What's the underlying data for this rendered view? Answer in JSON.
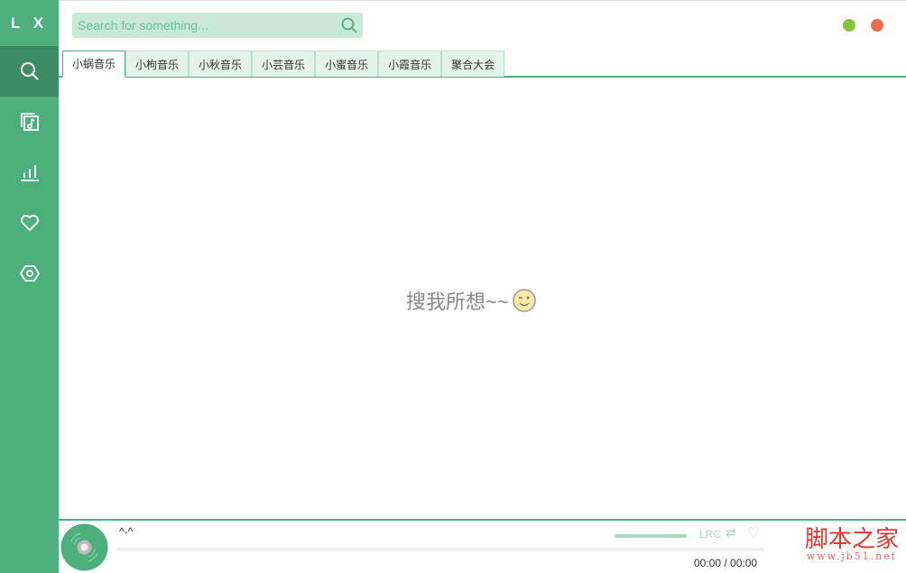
{
  "app": {
    "logo": "L X"
  },
  "sidebar": {
    "items": [
      {
        "name": "search"
      },
      {
        "name": "song-list"
      },
      {
        "name": "leaderboard"
      },
      {
        "name": "favorites"
      },
      {
        "name": "settings"
      }
    ]
  },
  "search": {
    "placeholder": "Search for something...",
    "value": ""
  },
  "tabs": [
    "小蜗音乐",
    "小枸音乐",
    "小秋音乐",
    "小芸音乐",
    "小蜜音乐",
    "小霞音乐",
    "聚合大会"
  ],
  "empty_text": "搜我所想~~",
  "player": {
    "title": "^-^",
    "time": "00:00 / 00:00",
    "lrc": "LRC",
    "progress": 0
  },
  "watermark": {
    "text": "脚本之家",
    "url": "www.jb51.net"
  },
  "colors": {
    "accent": "#4daf7c",
    "min": "#85c43b",
    "close": "#ec6c4f"
  }
}
